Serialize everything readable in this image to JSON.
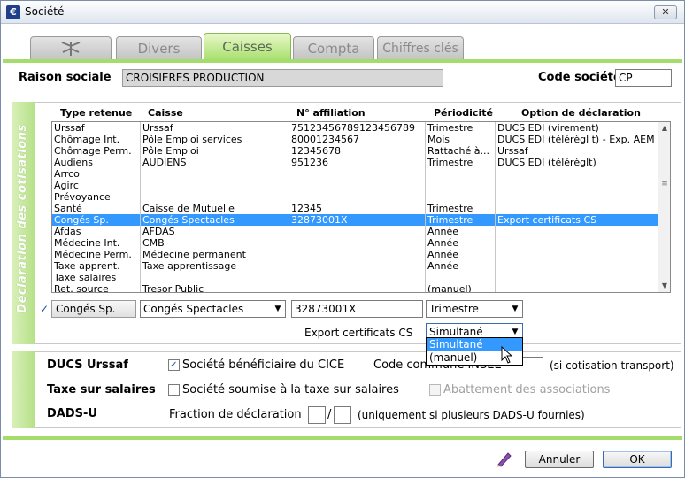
{
  "window": {
    "title": "Société",
    "close_label": "✕"
  },
  "tabs": [
    {
      "label": "",
      "icon": "dragonfly-icon"
    },
    {
      "label": "Divers"
    },
    {
      "label": "Caisses",
      "active": true
    },
    {
      "label": "Compta"
    },
    {
      "label": "Chiffres clés"
    }
  ],
  "company": {
    "raison_label": "Raison sociale",
    "raison_value": "CROISIERES PRODUCTION",
    "code_label": "Code société",
    "code_value": "CP"
  },
  "cotisations": {
    "side_title": "Déclaration des cotisations",
    "columns": [
      "Type retenue",
      "Caisse",
      "N° affiliation",
      "Périodicité",
      "Option de déclaration"
    ],
    "rows": [
      [
        "Urssaf",
        "Urssaf",
        "75123456789123456789",
        "Trimestre",
        "DUCS EDI (virement)"
      ],
      [
        "Chômage Int.",
        "Pôle Emploi services",
        "80001234567",
        "Mois",
        "DUCS EDI (télérègl t) - Exp. AEM"
      ],
      [
        "Chômage Perm.",
        "Pôle Emploi",
        "12345678",
        "Rattaché à...",
        "Urssaf"
      ],
      [
        "Audiens",
        "AUDIENS",
        "951236",
        "Trimestre",
        "DUCS EDI (télérèglt)"
      ],
      [
        "Arrco",
        "",
        "",
        "",
        ""
      ],
      [
        "Agirc",
        "",
        "",
        "",
        ""
      ],
      [
        "Prévoyance",
        "",
        "",
        "",
        ""
      ],
      [
        "Santé",
        "Caisse de Mutuelle",
        "12345",
        "Trimestre",
        ""
      ],
      [
        "Congés Sp.",
        "Congés Spectacles",
        "32873001X",
        "Trimestre",
        "Export certificats CS"
      ],
      [
        "Afdas",
        "AFDAS",
        "",
        "Année",
        ""
      ],
      [
        "Médecine Int.",
        "CMB",
        "",
        "Année",
        ""
      ],
      [
        "Médecine Perm.",
        "Médecine permanent",
        "",
        "Année",
        ""
      ],
      [
        "Taxe apprent.",
        "Taxe apprentissage",
        "",
        "Année",
        ""
      ],
      [
        "Taxe salaires",
        "",
        "",
        "",
        ""
      ],
      [
        "Ret. source",
        "Tresor Public",
        "",
        "(manuel)",
        ""
      ]
    ],
    "selected_row": 8,
    "edit": {
      "type": "Congés Sp.",
      "caisse": "Congés Spectacles",
      "affiliation": "32873001X",
      "periodicite": "Trimestre",
      "export_label": "Export certificats CS",
      "export_value": "Simultané",
      "export_options": [
        "Simultané",
        "(manuel)"
      ]
    }
  },
  "ducs": {
    "ducs_label": "DUCS Urssaf",
    "cice_label": "Société bénéficiaire du CICE",
    "cice_checked": "✓",
    "insee_label": "Code commune INSEE",
    "insee_note": "(si cotisation transport)",
    "taxe_label": "Taxe sur salaires",
    "taxe_cb_label": "Société soumise à la taxe sur salaires",
    "abattement_label": "Abattement des associations",
    "dads_label": "DADS-U",
    "fraction_label": "Fraction de déclaration",
    "fraction_sep": "/",
    "fraction_note": "(uniquement si plusieurs DADS-U fournies)"
  },
  "buttons": {
    "cancel": "Annuler",
    "ok": "OK"
  },
  "colors": {
    "accent_green": "#a5dd6c",
    "selection_blue": "#3399ff"
  }
}
